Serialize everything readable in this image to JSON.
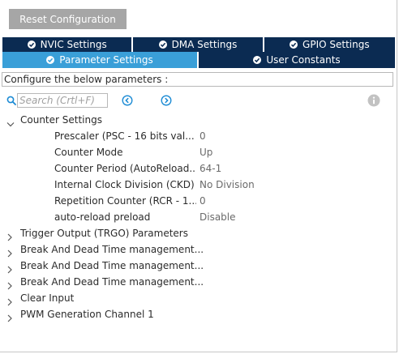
{
  "toolbar": {
    "reset_label": "Reset Configuration"
  },
  "tabs_row1": [
    {
      "label": "NVIC Settings"
    },
    {
      "label": "DMA Settings"
    },
    {
      "label": "GPIO Settings"
    }
  ],
  "tabs_row2": [
    {
      "label": "Parameter Settings",
      "active": true
    },
    {
      "label": "User Constants",
      "active": false
    }
  ],
  "config_label": "Configure the below parameters :",
  "search": {
    "placeholder": "Search (Crtl+F)"
  },
  "counter_settings": {
    "title": "Counter Settings",
    "params": [
      {
        "name": "Prescaler (PSC - 16 bits val...",
        "value": "0"
      },
      {
        "name": "Counter Mode",
        "value": "Up"
      },
      {
        "name": "Counter Period (AutoReload...",
        "value": "64-1"
      },
      {
        "name": "Internal Clock Division (CKD)",
        "value": "No Division"
      },
      {
        "name": "Repetition Counter (RCR - 1...",
        "value": "0"
      },
      {
        "name": "auto-reload preload",
        "value": "Disable"
      }
    ]
  },
  "collapsed_groups": [
    "Trigger Output (TRGO) Parameters",
    "Break And Dead Time management...",
    "Break And Dead Time management...",
    "Break And Dead Time management...",
    "Clear Input",
    "PWM Generation Channel 1"
  ],
  "colors": {
    "tab_dark": "#0b2b52",
    "tab_active": "#3a9fd8",
    "button_gray": "#a6a6a6",
    "nav_blue": "#1a8ad4"
  },
  "icons": {
    "search": "search-icon",
    "prev": "circle-chevron-left-icon",
    "next": "circle-chevron-right-icon",
    "info": "info-icon",
    "check": "check-circle-icon",
    "expanded": "chevron-down-icon",
    "collapsed": "chevron-right-icon"
  }
}
